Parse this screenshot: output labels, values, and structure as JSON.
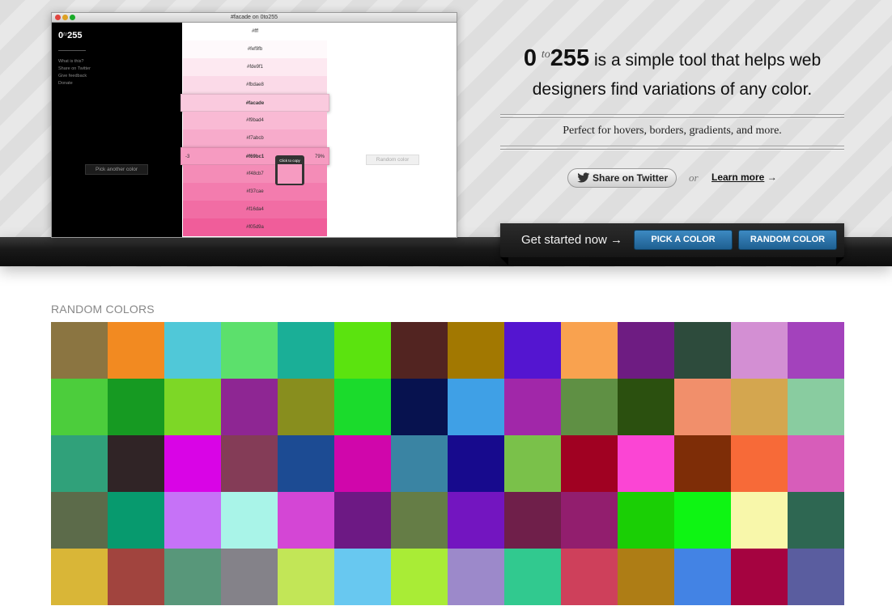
{
  "preview": {
    "window_title": "#facade on 0to255",
    "logo": {
      "zero": "0",
      "to": "to",
      "num": "255"
    },
    "nav": [
      "What is this?",
      "Share on Twitter",
      "Give feedback",
      "Donate"
    ],
    "pick_label": "Pick another color",
    "random_label": "Random color",
    "top_label": "#fff",
    "strips": [
      {
        "hex": "#fef9fb",
        "color": "#fef9fb"
      },
      {
        "hex": "#fde9f1",
        "color": "#fde9f1"
      },
      {
        "hex": "#fbdae8",
        "color": "#fbdae8"
      },
      {
        "hex": "#facade",
        "color": "#facade",
        "selected": true
      },
      {
        "hex": "#f9bad4",
        "color": "#f9bad4"
      },
      {
        "hex": "#f7abcb",
        "color": "#f7abcb"
      },
      {
        "hex": "#f69bc1",
        "color": "#f69bc1",
        "selected": true,
        "left": "-3",
        "right": "79%"
      },
      {
        "hex": "#f48cb7",
        "color": "#f48cb7"
      },
      {
        "hex": "#f37cae",
        "color": "#f37cae"
      },
      {
        "hex": "#f16da4",
        "color": "#f16da4"
      },
      {
        "hex": "#f05d9a",
        "color": "#f05d9a"
      }
    ],
    "copy_tip": {
      "label": "Click to copy",
      "color": "#f69bc1"
    }
  },
  "headline": {
    "zero": "0",
    "to": "to",
    "num": "255",
    "line1_rest": " is a simple tool that helps web",
    "line2": "designers find variations of any color."
  },
  "tagline": "Perfect for hovers, borders, gradients, and more.",
  "share": {
    "twitter_label": "Share on Twitter",
    "or": "or",
    "learn_more": "Learn more",
    "learn_more_arrow": "→"
  },
  "get_started": {
    "text": "Get started now →",
    "pick": "PICK A COLOR",
    "random": "RANDOM COLOR"
  },
  "random_colors": {
    "title": "RANDOM COLORS",
    "colors": [
      "#8b7541",
      "#f28a21",
      "#50c8d8",
      "#5ce06c",
      "#1aaf97",
      "#5be30f",
      "#522421",
      "#a27801",
      "#5415d0",
      "#f9a24f",
      "#6e1c82",
      "#2d4b3c",
      "#d38fd3",
      "#a342bc",
      "#4ccd3c",
      "#169a22",
      "#7dd726",
      "#8e2693",
      "#888e1e",
      "#1bdb2c",
      "#07124f",
      "#3fa0e6",
      "#a127a9",
      "#5f9044",
      "#2b500f",
      "#f18f6b",
      "#d4a64f",
      "#89cca0",
      "#30a17a",
      "#302426",
      "#d904e6",
      "#843c57",
      "#1c4b93",
      "#d006ab",
      "#3a84a3",
      "#170a8d",
      "#7ac14a",
      "#a00122",
      "#fb45d4",
      "#7e2d07",
      "#f76a38",
      "#d75dba",
      "#5c6b4a",
      "#079a6e",
      "#c672f7",
      "#a9f4e8",
      "#d446d5",
      "#6d1984",
      "#657d46",
      "#7315c0",
      "#6f1f4a",
      "#921e6e",
      "#1acf05",
      "#0ef513",
      "#f8f7aa",
      "#2e6752",
      "#d9b637",
      "#a1443e",
      "#58977a",
      "#848289",
      "#c2e657",
      "#68c8f0",
      "#a9ec36",
      "#9c89ca",
      "#31c98f",
      "#ce405b",
      "#ae7d15",
      "#4383e4",
      "#a50340",
      "#5a5d9f"
    ]
  }
}
